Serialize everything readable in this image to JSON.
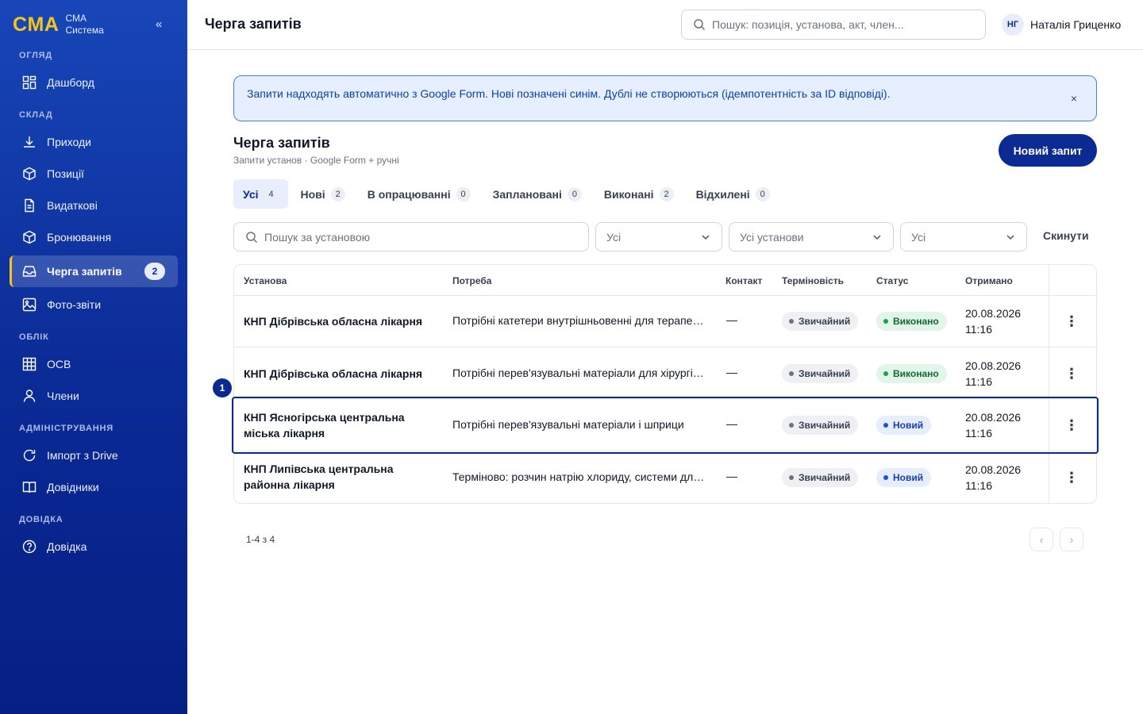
{
  "app": {
    "logo": "CMA",
    "name_line1": "СМА",
    "name_line2": "Система",
    "collapse": "«"
  },
  "sidebar": {
    "sections": [
      {
        "label": "Огляд"
      },
      {
        "label": "Склад"
      },
      {
        "label": "Облік"
      },
      {
        "label": "Адміністрування"
      },
      {
        "label": "Довідка"
      }
    ],
    "items": [
      {
        "label": "Дашборд",
        "icon": "dashboard-icon"
      },
      {
        "label": "Приходи",
        "icon": "download-icon"
      },
      {
        "label": "Позиції",
        "icon": "box-icon"
      },
      {
        "label": "Видаткові",
        "icon": "document-icon"
      },
      {
        "label": "Бронювання",
        "icon": "box-icon"
      },
      {
        "label": "Черга запитів",
        "icon": "inbox-icon",
        "badge": "2"
      },
      {
        "label": "Фото-звіти",
        "icon": "image-icon"
      },
      {
        "label": "ОСВ",
        "icon": "grid-icon"
      },
      {
        "label": "Члени",
        "icon": "user-icon"
      },
      {
        "label": "Імпорт з Drive",
        "icon": "refresh-icon"
      },
      {
        "label": "Довідники",
        "icon": "book-icon"
      },
      {
        "label": "Довідка",
        "icon": "help-icon"
      }
    ]
  },
  "header": {
    "title": "Черга запитів",
    "search_placeholder": "Пошук: позиція, установа, акт, член...",
    "user_initials": "НГ",
    "user_name": "Наталія Гриценко"
  },
  "banner": {
    "text": "Запити надходять автоматично з Google Form. Нові позначені синім. Дублі не створюються (ідемпотентність за ID відповіді).",
    "close": "×"
  },
  "queue": {
    "title": "Черга запитів",
    "subtitle": "Запити установ · Google Form + ручні",
    "new_button": "Новий запит"
  },
  "tabs": [
    {
      "label": "Усі",
      "count": "4"
    },
    {
      "label": "Нові",
      "count": "2"
    },
    {
      "label": "В опрацюванні",
      "count": "0"
    },
    {
      "label": "Заплановані",
      "count": "0"
    },
    {
      "label": "Виконані",
      "count": "2"
    },
    {
      "label": "Відхилені",
      "count": "0"
    }
  ],
  "filters": {
    "search_placeholder": "Пошук за установою",
    "select1": "Усі",
    "select2": "Усі установи",
    "select3": "Усі",
    "reset": "Скинути"
  },
  "table": {
    "columns": [
      "Установа",
      "Потреба",
      "Контакт",
      "Терміновість",
      "Статус",
      "Отримано"
    ],
    "rows": [
      {
        "institution": "КНП Дібрівська обласна лікарня",
        "need": "Потрібні катетери внутрішньовенні для терапевтичного відділення",
        "contact": "—",
        "urgency": "Звичайний",
        "status": "Виконано",
        "date": "20.08.2026",
        "time": "11:16"
      },
      {
        "institution": "КНП Дібрівська обласна лікарня",
        "need": "Потрібні перев'язувальні матеріали для хірургічного відділення",
        "contact": "—",
        "urgency": "Звичайний",
        "status": "Виконано",
        "date": "20.08.2026",
        "time": "11:16"
      },
      {
        "institution": "КНП Ясногірська центральна міська лікарня",
        "need": "Потрібні перев'язувальні матеріали і шприци",
        "contact": "—",
        "urgency": "Звичайний",
        "status": "Новий",
        "date": "20.08.2026",
        "time": "11:16"
      },
      {
        "institution": "КНП Липівська центральна районна лікарня",
        "need": "Терміново: розчин натрію хлориду, системи для інфузій",
        "contact": "—",
        "urgency": "Звичайний",
        "status": "Новий",
        "date": "20.08.2026",
        "time": "11:16"
      }
    ],
    "row_menu": "⋮"
  },
  "annotation": {
    "marker": "1"
  },
  "pagination": {
    "info": "1-4 з 4",
    "prev": "‹",
    "next": "›"
  },
  "colors": {
    "primary": "#0b2a94",
    "accent": "#f5c518",
    "sidebar": "#0a2a95",
    "banner_bg": "#e6efff",
    "success": "#16a34a"
  }
}
